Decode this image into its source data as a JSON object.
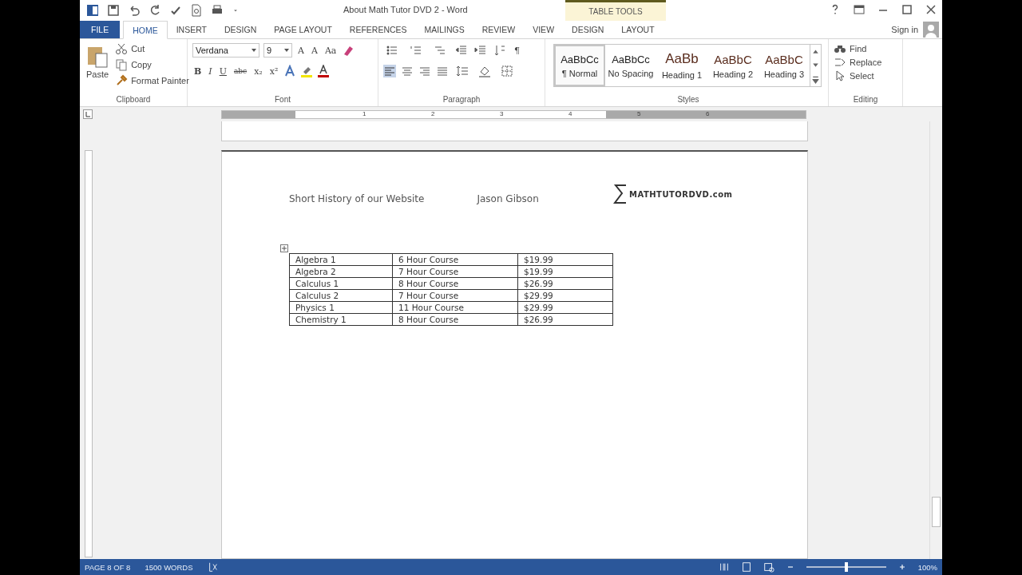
{
  "window": {
    "title": "About Math Tutor DVD 2 - Word",
    "contextual_label": "TABLE TOOLS"
  },
  "tabs": [
    {
      "label": "FILE",
      "kind": "file",
      "selected": false
    },
    {
      "label": "HOME",
      "kind": "tab",
      "selected": true
    },
    {
      "label": "INSERT",
      "kind": "tab",
      "selected": false
    },
    {
      "label": "DESIGN",
      "kind": "tab",
      "selected": false
    },
    {
      "label": "PAGE LAYOUT",
      "kind": "tab",
      "selected": false
    },
    {
      "label": "REFERENCES",
      "kind": "tab",
      "selected": false
    },
    {
      "label": "MAILINGS",
      "kind": "tab",
      "selected": false
    },
    {
      "label": "REVIEW",
      "kind": "tab",
      "selected": false
    },
    {
      "label": "VIEW",
      "kind": "tab",
      "selected": false
    },
    {
      "label": "DESIGN",
      "kind": "context",
      "selected": false
    },
    {
      "label": "LAYOUT",
      "kind": "context",
      "selected": false
    }
  ],
  "account": {
    "label": "Sign in"
  },
  "ribbon": {
    "clipboard": {
      "label": "Clipboard",
      "paste": "Paste",
      "items": [
        "Cut",
        "Copy",
        "Format Painter"
      ]
    },
    "font": {
      "label": "Font",
      "family": "Verdana",
      "size": "9",
      "size_buttons": [
        "A",
        "A",
        "Aa"
      ],
      "format_buttons": [
        "B",
        "I",
        "U",
        "abc",
        "x₂",
        "x²"
      ]
    },
    "paragraph": {
      "label": "Paragraph",
      "pilcrow": "¶"
    },
    "styles": {
      "label": "Styles",
      "items": [
        {
          "sample": "AaBbCc",
          "name": "¶ Normal",
          "selected": true
        },
        {
          "sample": "AaBbCc",
          "name": "No Spacing",
          "selected": false
        },
        {
          "sample": "AaBb",
          "name": "Heading 1",
          "selected": false
        },
        {
          "sample": "AaBbC",
          "name": "Heading 2",
          "selected": false
        },
        {
          "sample": "AaBbC",
          "name": "Heading 3",
          "selected": false
        }
      ]
    },
    "editing": {
      "label": "Editing",
      "items": [
        "Find",
        "Replace",
        "Select"
      ]
    }
  },
  "ruler": [
    "1",
    "2",
    "3",
    "4",
    "5",
    "6"
  ],
  "document": {
    "header": {
      "title": "Short History of our Website",
      "author": "Jason Gibson",
      "logo": "MATHTUTORDVD.com"
    },
    "table": {
      "rows": [
        [
          "Algebra 1",
          "6 Hour Course",
          "$19.99"
        ],
        [
          "Algebra 2",
          "7 Hour Course",
          "$19.99"
        ],
        [
          "Calculus 1",
          "8 Hour Course",
          "$26.99"
        ],
        [
          "Calculus 2",
          "7 Hour Course",
          "$29.99"
        ],
        [
          "Physics 1",
          "11 Hour Course",
          "$29.99"
        ],
        [
          "Chemistry 1",
          "8 Hour Course",
          "$26.99"
        ]
      ]
    }
  },
  "status_bar": {
    "page": "PAGE 8 OF 8",
    "words": "1500 WORDS",
    "zoom": {
      "level": 0.5,
      "reading": "100%"
    }
  }
}
